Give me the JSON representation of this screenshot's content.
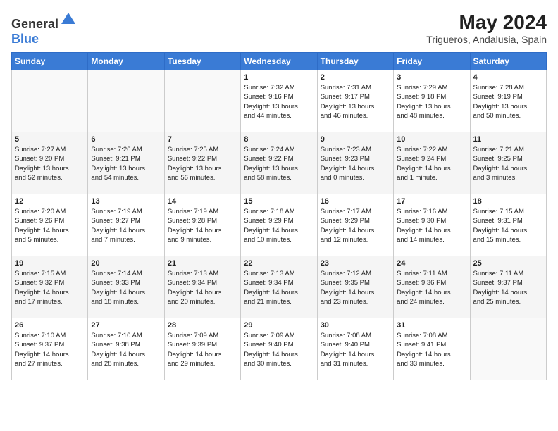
{
  "header": {
    "logo_general": "General",
    "logo_blue": "Blue",
    "month": "May 2024",
    "location": "Trigueros, Andalusia, Spain"
  },
  "days_of_week": [
    "Sunday",
    "Monday",
    "Tuesday",
    "Wednesday",
    "Thursday",
    "Friday",
    "Saturday"
  ],
  "weeks": [
    [
      {
        "day": "",
        "info": ""
      },
      {
        "day": "",
        "info": ""
      },
      {
        "day": "",
        "info": ""
      },
      {
        "day": "1",
        "info": "Sunrise: 7:32 AM\nSunset: 9:16 PM\nDaylight: 13 hours\nand 44 minutes."
      },
      {
        "day": "2",
        "info": "Sunrise: 7:31 AM\nSunset: 9:17 PM\nDaylight: 13 hours\nand 46 minutes."
      },
      {
        "day": "3",
        "info": "Sunrise: 7:29 AM\nSunset: 9:18 PM\nDaylight: 13 hours\nand 48 minutes."
      },
      {
        "day": "4",
        "info": "Sunrise: 7:28 AM\nSunset: 9:19 PM\nDaylight: 13 hours\nand 50 minutes."
      }
    ],
    [
      {
        "day": "5",
        "info": "Sunrise: 7:27 AM\nSunset: 9:20 PM\nDaylight: 13 hours\nand 52 minutes."
      },
      {
        "day": "6",
        "info": "Sunrise: 7:26 AM\nSunset: 9:21 PM\nDaylight: 13 hours\nand 54 minutes."
      },
      {
        "day": "7",
        "info": "Sunrise: 7:25 AM\nSunset: 9:22 PM\nDaylight: 13 hours\nand 56 minutes."
      },
      {
        "day": "8",
        "info": "Sunrise: 7:24 AM\nSunset: 9:22 PM\nDaylight: 13 hours\nand 58 minutes."
      },
      {
        "day": "9",
        "info": "Sunrise: 7:23 AM\nSunset: 9:23 PM\nDaylight: 14 hours\nand 0 minutes."
      },
      {
        "day": "10",
        "info": "Sunrise: 7:22 AM\nSunset: 9:24 PM\nDaylight: 14 hours\nand 1 minute."
      },
      {
        "day": "11",
        "info": "Sunrise: 7:21 AM\nSunset: 9:25 PM\nDaylight: 14 hours\nand 3 minutes."
      }
    ],
    [
      {
        "day": "12",
        "info": "Sunrise: 7:20 AM\nSunset: 9:26 PM\nDaylight: 14 hours\nand 5 minutes."
      },
      {
        "day": "13",
        "info": "Sunrise: 7:19 AM\nSunset: 9:27 PM\nDaylight: 14 hours\nand 7 minutes."
      },
      {
        "day": "14",
        "info": "Sunrise: 7:19 AM\nSunset: 9:28 PM\nDaylight: 14 hours\nand 9 minutes."
      },
      {
        "day": "15",
        "info": "Sunrise: 7:18 AM\nSunset: 9:29 PM\nDaylight: 14 hours\nand 10 minutes."
      },
      {
        "day": "16",
        "info": "Sunrise: 7:17 AM\nSunset: 9:29 PM\nDaylight: 14 hours\nand 12 minutes."
      },
      {
        "day": "17",
        "info": "Sunrise: 7:16 AM\nSunset: 9:30 PM\nDaylight: 14 hours\nand 14 minutes."
      },
      {
        "day": "18",
        "info": "Sunrise: 7:15 AM\nSunset: 9:31 PM\nDaylight: 14 hours\nand 15 minutes."
      }
    ],
    [
      {
        "day": "19",
        "info": "Sunrise: 7:15 AM\nSunset: 9:32 PM\nDaylight: 14 hours\nand 17 minutes."
      },
      {
        "day": "20",
        "info": "Sunrise: 7:14 AM\nSunset: 9:33 PM\nDaylight: 14 hours\nand 18 minutes."
      },
      {
        "day": "21",
        "info": "Sunrise: 7:13 AM\nSunset: 9:34 PM\nDaylight: 14 hours\nand 20 minutes."
      },
      {
        "day": "22",
        "info": "Sunrise: 7:13 AM\nSunset: 9:34 PM\nDaylight: 14 hours\nand 21 minutes."
      },
      {
        "day": "23",
        "info": "Sunrise: 7:12 AM\nSunset: 9:35 PM\nDaylight: 14 hours\nand 23 minutes."
      },
      {
        "day": "24",
        "info": "Sunrise: 7:11 AM\nSunset: 9:36 PM\nDaylight: 14 hours\nand 24 minutes."
      },
      {
        "day": "25",
        "info": "Sunrise: 7:11 AM\nSunset: 9:37 PM\nDaylight: 14 hours\nand 25 minutes."
      }
    ],
    [
      {
        "day": "26",
        "info": "Sunrise: 7:10 AM\nSunset: 9:37 PM\nDaylight: 14 hours\nand 27 minutes."
      },
      {
        "day": "27",
        "info": "Sunrise: 7:10 AM\nSunset: 9:38 PM\nDaylight: 14 hours\nand 28 minutes."
      },
      {
        "day": "28",
        "info": "Sunrise: 7:09 AM\nSunset: 9:39 PM\nDaylight: 14 hours\nand 29 minutes."
      },
      {
        "day": "29",
        "info": "Sunrise: 7:09 AM\nSunset: 9:40 PM\nDaylight: 14 hours\nand 30 minutes."
      },
      {
        "day": "30",
        "info": "Sunrise: 7:08 AM\nSunset: 9:40 PM\nDaylight: 14 hours\nand 31 minutes."
      },
      {
        "day": "31",
        "info": "Sunrise: 7:08 AM\nSunset: 9:41 PM\nDaylight: 14 hours\nand 33 minutes."
      },
      {
        "day": "",
        "info": ""
      }
    ]
  ]
}
